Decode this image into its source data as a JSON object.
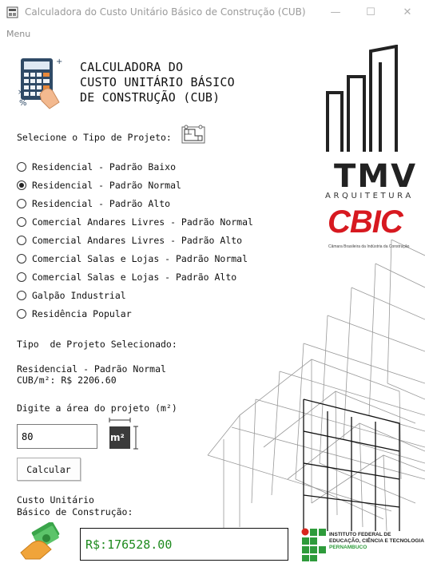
{
  "window": {
    "title": "Calculadora do Custo Unitário Básico de Construção (CUB)",
    "minimize_symbol": "—",
    "maximize_symbol": "☐",
    "close_symbol": "✕"
  },
  "menu": {
    "label": "Menu"
  },
  "app_title": "CALCULADORA DO\nCUSTO UNITÁRIO BÁSICO\nDE CONSTRUÇÃO (CUB)",
  "select_label": "Selecione o Tipo de Projeto:",
  "options": [
    {
      "label": "Residencial - Padrão Baixo",
      "selected": false
    },
    {
      "label": "Residencial - Padrão Normal",
      "selected": true
    },
    {
      "label": "Residencial - Padrão Alto",
      "selected": false
    },
    {
      "label": "Comercial Andares Livres - Padrão Normal",
      "selected": false
    },
    {
      "label": "Comercial Andares Livres - Padrão Alto",
      "selected": false
    },
    {
      "label": "Comercial Salas e Lojas - Padrão Normal",
      "selected": false
    },
    {
      "label": "Comercial Salas e Lojas - Padrão Alto",
      "selected": false
    },
    {
      "label": "Galpão Industrial",
      "selected": false
    },
    {
      "label": "Residência Popular",
      "selected": false
    }
  ],
  "selected_heading": "Tipo  de Projeto Selecionado:",
  "selected_type": "Residencial - Padrão Normal",
  "cub_value": "CUB/m²: R$ 2206.60",
  "area_label": "Digite a área do projeto (m²)",
  "area_value": "80",
  "area_unit_icon": "m²",
  "calc_button": "Calcular",
  "result_label": "Custo Unitário\nBásico de Construção:",
  "result_value": "R$:176528.00",
  "logos": {
    "tmv": "TMV",
    "tmv_sub": "ARQUITETURA",
    "cbic": "CBIC",
    "cbic_sub": "Câmara Brasileira da Indústria da Construção",
    "if_line1": "INSTITUTO FEDERAL DE",
    "if_line2": "EDUCAÇÃO, CIÊNCIA E TECNOLOGIA",
    "if_line3": "PERNAMBUCO"
  },
  "colors": {
    "result_text": "#1e8a1e",
    "cbic_red": "#d71920",
    "if_green": "#2e9b3b"
  }
}
